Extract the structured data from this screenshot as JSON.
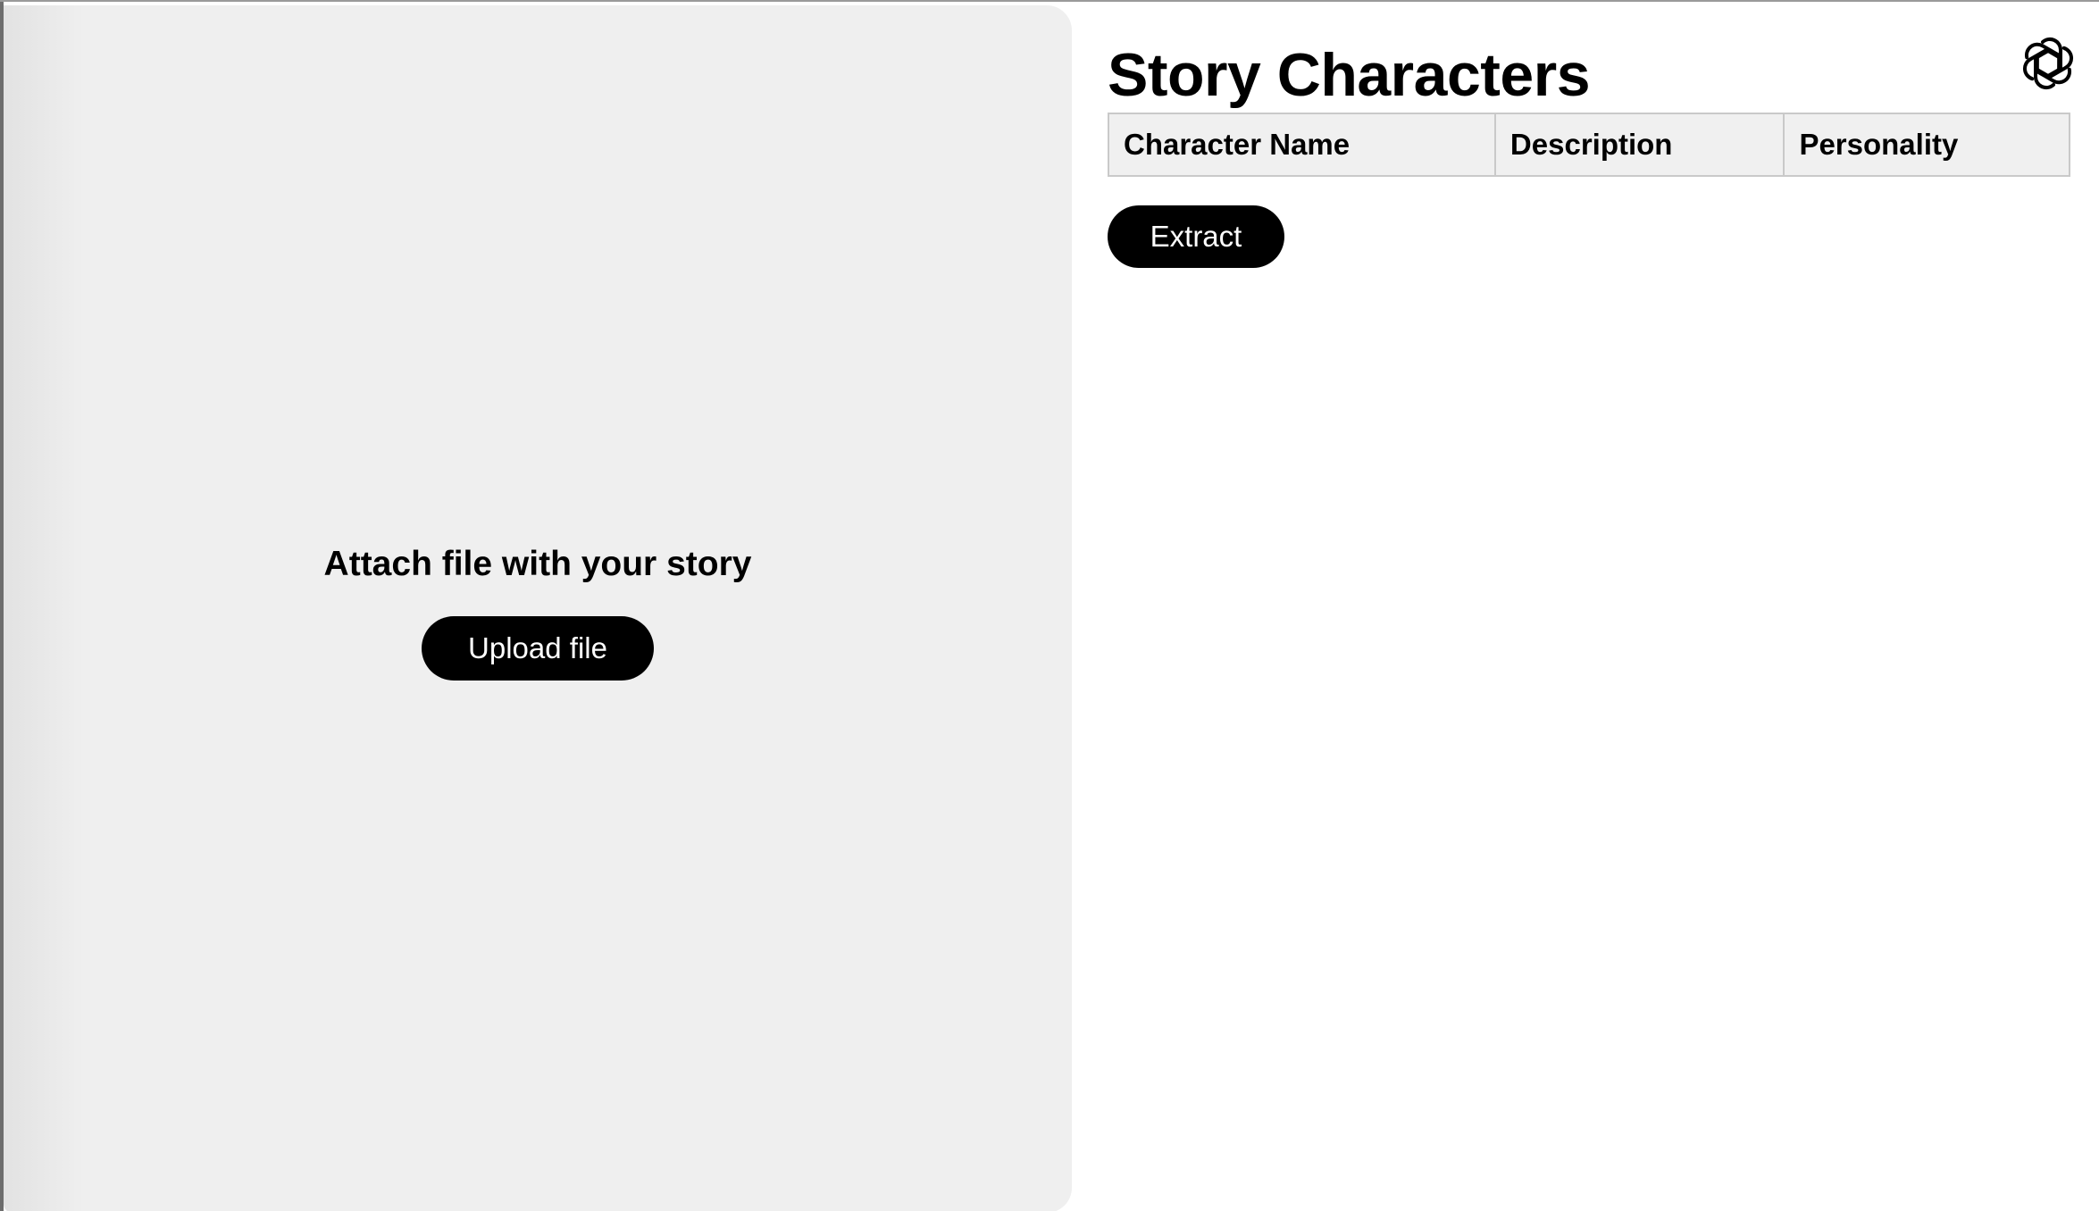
{
  "upload_panel": {
    "heading": "Attach file with your story",
    "upload_button_label": "Upload file"
  },
  "main": {
    "title": "Story Characters",
    "table": {
      "columns": [
        "Character Name",
        "Description",
        "Personality"
      ],
      "rows": []
    },
    "extract_button_label": "Extract"
  },
  "logo": {
    "icon": "openai-logo-icon"
  },
  "colors": {
    "panel_background": "#efefef",
    "button_background": "#000000",
    "button_text": "#ffffff",
    "table_header_background": "#f0f0f0",
    "table_border": "#c9c9c9"
  }
}
